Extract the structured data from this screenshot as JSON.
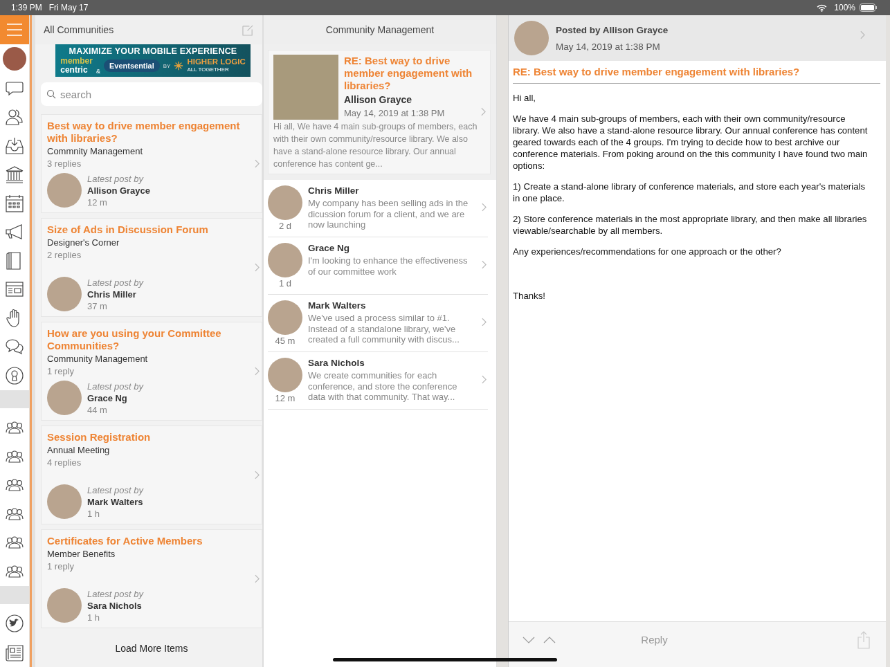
{
  "status_bar": {
    "time": "1:39 PM",
    "date": "Fri May 17",
    "battery": "100%"
  },
  "communities_panel": {
    "title": "All Communities",
    "banner": {
      "headline": "MAXIMIZE YOUR MOBILE EXPERIENCE",
      "brand_1_top": "member",
      "brand_1_bottom": "centric",
      "ampersand": "&",
      "brand_2": "Eventsential",
      "by": "BY",
      "brand_3": "HIGHER LOGIC",
      "brand_3_tagline": "ALL TOGETHER"
    },
    "search": {
      "placeholder": "search"
    },
    "threads": [
      {
        "title": "Best way to drive member engagement with libraries?",
        "community": "Commnity Management",
        "replies": "3 replies",
        "latest_label": "Latest post by",
        "author": "Allison Grayce",
        "age": "12 m"
      },
      {
        "title": "Size of Ads in Discussion Forum",
        "community": "Designer's Corner",
        "replies": "2 replies",
        "latest_label": "Latest post by",
        "author": "Chris Miller",
        "age": "37 m"
      },
      {
        "title": "How are you using your Committee Communities?",
        "community": "Community Management",
        "replies": "1 reply",
        "latest_label": "Latest post by",
        "author": "Grace Ng",
        "age": "44 m"
      },
      {
        "title": "Session Registration",
        "community": "Annual Meeting",
        "replies": "4 replies",
        "latest_label": "Latest post by",
        "author": "Mark Walters",
        "age": "1 h"
      },
      {
        "title": "Certificates for Active Members",
        "community": "Member Benefits",
        "replies": "1 reply",
        "latest_label": "Latest post by",
        "author": "Sara Nichols",
        "age": "1 h"
      }
    ],
    "load_more": "Load More Items"
  },
  "thread_panel": {
    "title": "Community Management",
    "featured": {
      "title": "RE: Best way to drive member engagement with libraries?",
      "author": "Allison Grayce",
      "date": "May 14, 2019 at 1:38 PM",
      "excerpt": "Hi all, We have 4 main sub-groups of members, each with their own community/resource library. We also have a stand-alone resource library. Our annual conference has content ge..."
    },
    "replies": [
      {
        "author": "Chris Miller",
        "age": "2 d",
        "excerpt": "My company has been selling ads in the dicussion forum for a client, and we are now launching"
      },
      {
        "author": "Grace Ng",
        "age": "1 d",
        "excerpt": "I'm looking to enhance the effectiveness of our committee work"
      },
      {
        "author": "Mark Walters",
        "age": "45 m",
        "excerpt": "We've used a process similar to #1. Instead of a standalone library, we've created a full community with discus..."
      },
      {
        "author": "Sara Nichols",
        "age": "12 m",
        "excerpt": "We create communities for each conference, and store the conference data with that community.  That way..."
      }
    ]
  },
  "post_panel": {
    "posted_by": "Posted by Allison Grayce",
    "date": "May 14, 2019 at 1:38 PM",
    "title": "RE: Best way to drive member engagement with libraries?",
    "paragraphs": [
      "Hi all,",
      "We have 4 main sub-groups of members, each with their own community/resource library.  We also have a stand-alone resource library.  Our annual conference has content geared towards each of the 4 groups.  I'm trying to decide how to best archive our conference materials.  From poking around on the this community I have found two main options:",
      "1) Create a stand-alone library of conference materials, and store each year's materials in one place.",
      "2) Store conference materials in the most appropriate library, and then make all libraries viewable/searchable by all members.",
      "Any experiences/recommendations for one approach or the other?",
      "Thanks!"
    ],
    "reply_label": "Reply"
  }
}
